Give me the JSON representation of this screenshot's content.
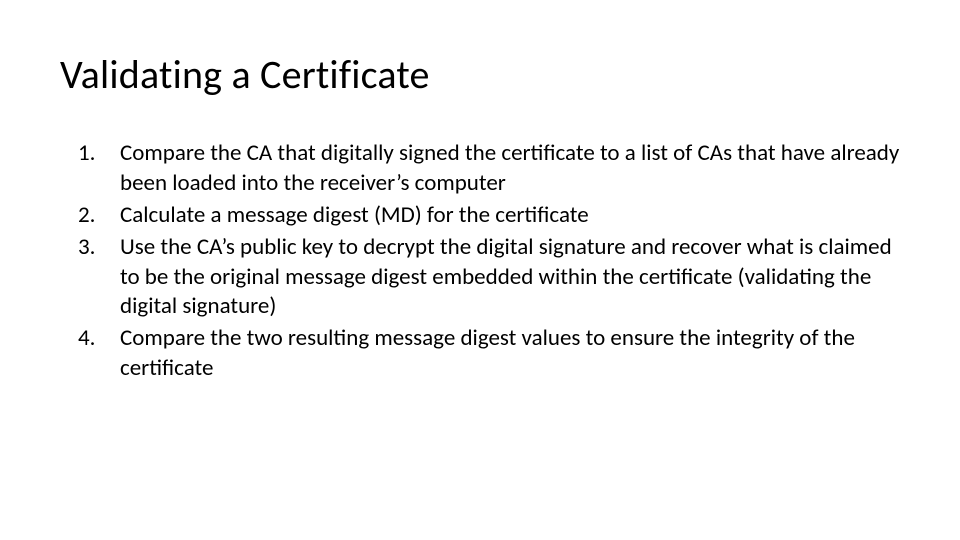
{
  "title": "Validating a Certificate",
  "items": [
    "Compare the CA that digitally signed the certificate to a list of CAs that have already been loaded into the receiver’s computer",
    "Calculate a message digest (MD) for the certificate",
    "Use the CA’s public key to decrypt the digital signature and recover what is claimed to be the original message digest embedded within the certificate (validating the digital signature)",
    "Compare the two resulting message digest values to ensure the integrity of the certificate"
  ]
}
